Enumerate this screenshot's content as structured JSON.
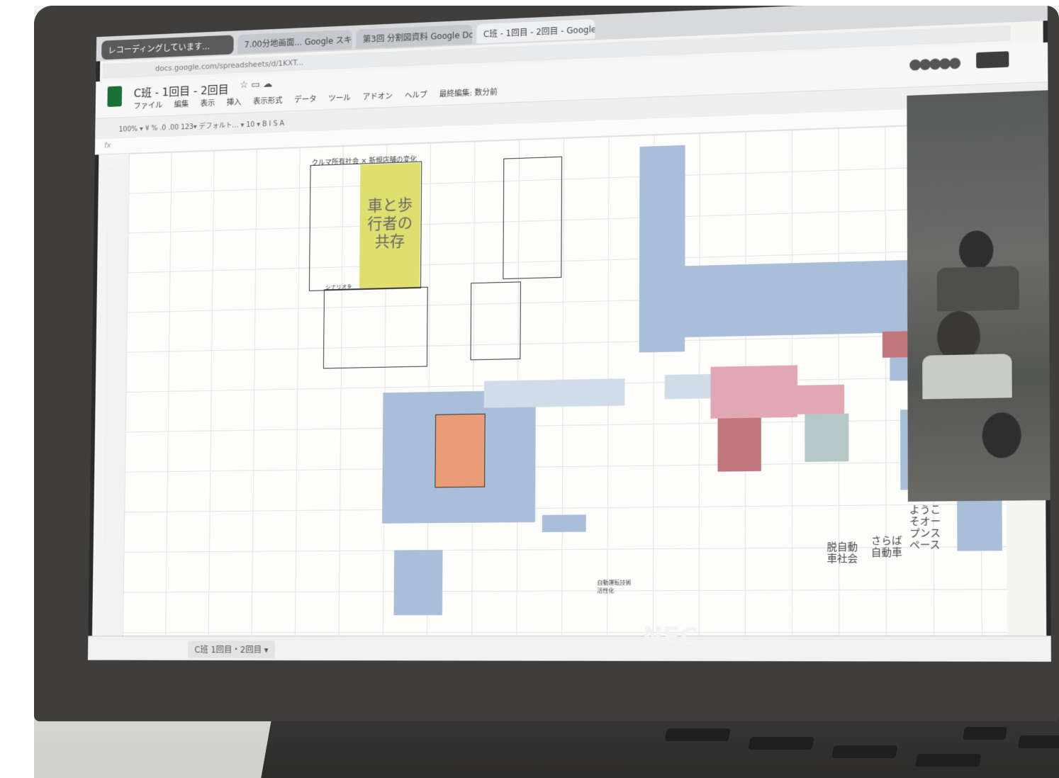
{
  "browser": {
    "recording_tab": "レコーディングしています...",
    "tab2": "7.00分地画面... Google スキ...",
    "tab3": "第3回 分割図資料 Google Docs...",
    "active_tab": "C班 - 1回目 - 2回目 - Google ...",
    "address": "docs.google.com/spreadsheets/d/1KXT..."
  },
  "sheet": {
    "title": "C班 - 1回目 - 2回目",
    "menu": [
      "ファイル",
      "編集",
      "表示",
      "挿入",
      "表示形式",
      "データ",
      "ツール",
      "アドオン",
      "ヘルプ",
      "最終編集: 数分前"
    ],
    "toolbar": "100% ▾  ¥  %  .0  .00  123▾  デフォルト...  ▾  10  ▾  B  I  S  A",
    "fx": "fx",
    "tab_name": "C班 1回目・2回目 ▾",
    "header_note": "クルマ所有社会 × 新規店舗の変化",
    "yellow_block": "車と歩\n行者の\n共存",
    "scenario_label": "シナリオを",
    "bottom_labels": {
      "label1": "脱自動\n車社会",
      "label2": "さらば\n自動車",
      "label3": "ようこ\nそオー\nプンス\nペース"
    },
    "misc_note": "自動運転技術\n活性化"
  },
  "laptop": {
    "brand": "NEC"
  }
}
